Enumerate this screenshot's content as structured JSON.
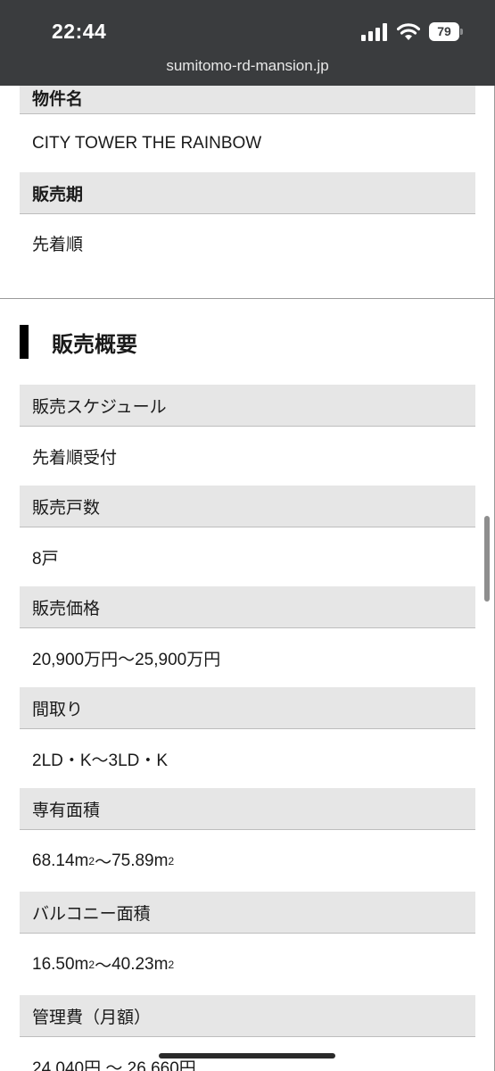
{
  "status_bar": {
    "time": "22:44",
    "battery": "79",
    "icons": [
      "signal-icon",
      "wifi-icon",
      "battery-icon"
    ]
  },
  "browser": {
    "url": "sumitomo-rd-mansion.jp"
  },
  "property": {
    "name_label": "物件名",
    "name_value": "CITY TOWER THE RAINBOW",
    "period_label": "販売期",
    "period_value": "先着順"
  },
  "overview": {
    "title": "販売概要",
    "schedule_label": "販売スケジュール",
    "schedule_value": "先着順受付",
    "units_label": "販売戸数",
    "units_value": "8戸",
    "price_label": "販売価格",
    "price_value": "20,900万円～25,900万円",
    "layout_label": "間取り",
    "layout_value": "2LD・K～3LD・K",
    "area_label": "専有面積",
    "area_from": "68.14m",
    "area_to": "75.89m",
    "balcony_label": "バルコニー面積",
    "balcony_from": "16.50m",
    "balcony_to": "40.23m",
    "sup": "2",
    "sep": "～",
    "mgmt_label": "管理費（月額）",
    "mgmt_value": "24,040円 ～ 26,660円"
  }
}
